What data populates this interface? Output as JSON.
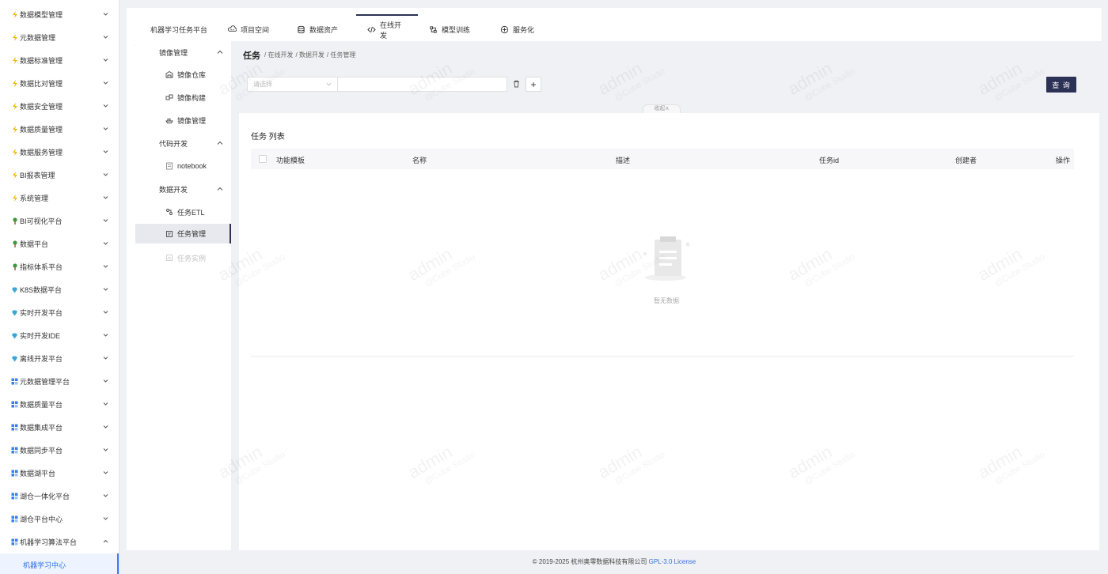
{
  "sidebar": {
    "items": [
      {
        "label": "数据模型管理",
        "icon": "lightning-icon",
        "color": "#f5b800"
      },
      {
        "label": "元数据管理",
        "icon": "lightning-icon",
        "color": "#f5b800"
      },
      {
        "label": "数据标准管理",
        "icon": "lightning-icon",
        "color": "#f5b800"
      },
      {
        "label": "数据比对管理",
        "icon": "lightning-icon",
        "color": "#f5b800"
      },
      {
        "label": "数据安全管理",
        "icon": "lightning-icon",
        "color": "#f5b800"
      },
      {
        "label": "数据质量管理",
        "icon": "lightning-icon",
        "color": "#f5b800"
      },
      {
        "label": "数据服务管理",
        "icon": "lightning-icon",
        "color": "#f5b800"
      },
      {
        "label": "BI报表管理",
        "icon": "lightning-icon",
        "color": "#f5b800"
      },
      {
        "label": "系统管理",
        "icon": "lightning-icon",
        "color": "#f5b800"
      },
      {
        "label": "BI可视化平台",
        "icon": "tree-icon",
        "color": "#3a9a3a"
      },
      {
        "label": "数据平台",
        "icon": "tree-icon",
        "color": "#3a9a3a"
      },
      {
        "label": "指标体系平台",
        "icon": "tree-icon",
        "color": "#3a9a3a"
      },
      {
        "label": "K8S数据平台",
        "icon": "diamond-icon",
        "color": "#3aa7d9"
      },
      {
        "label": "实时开发平台",
        "icon": "diamond-icon",
        "color": "#3aa7d9"
      },
      {
        "label": "实时开发IDE",
        "icon": "diamond-icon",
        "color": "#3aa7d9"
      },
      {
        "label": "离线开发平台",
        "icon": "diamond-icon",
        "color": "#3aa7d9"
      },
      {
        "label": "元数据管理平台",
        "icon": "grid-icon",
        "color": "#3a7df0"
      },
      {
        "label": "数据质量平台",
        "icon": "grid-icon",
        "color": "#3a7df0"
      },
      {
        "label": "数据集成平台",
        "icon": "grid-icon",
        "color": "#3a7df0"
      },
      {
        "label": "数据同步平台",
        "icon": "grid-icon",
        "color": "#3a7df0"
      },
      {
        "label": "数据湖平台",
        "icon": "grid-icon",
        "color": "#3a7df0"
      },
      {
        "label": "湖仓一体化平台",
        "icon": "grid-icon",
        "color": "#3a7df0"
      },
      {
        "label": "湖仓平台中心",
        "icon": "grid-icon",
        "color": "#3a7df0"
      },
      {
        "label": "机器学习算法平台",
        "icon": "grid-icon",
        "color": "#3a7df0"
      }
    ],
    "sub_item": "机器学习中心"
  },
  "topnav": {
    "app_name": "机器学习任务平台",
    "tabs": [
      {
        "label": "项目空间",
        "icon": "cloud-icon"
      },
      {
        "label": "数据资产",
        "icon": "database-icon"
      },
      {
        "label": "在线开发",
        "icon": "code-icon"
      },
      {
        "label": "模型训练",
        "icon": "model-icon"
      },
      {
        "label": "服务化",
        "icon": "service-icon"
      }
    ]
  },
  "subnav": {
    "groups": [
      {
        "label": "镜像管理",
        "items": [
          {
            "label": "镜像仓库",
            "icon": "warehouse-icon"
          },
          {
            "label": "镜像构建",
            "icon": "blocks-icon"
          },
          {
            "label": "镜像管理",
            "icon": "ship-icon"
          }
        ]
      },
      {
        "label": "代码开发",
        "items": [
          {
            "label": "notebook",
            "icon": "notebook-icon"
          }
        ]
      },
      {
        "label": "数据开发",
        "items": [
          {
            "label": "任务ETL",
            "icon": "etl-icon"
          },
          {
            "label": "任务管理",
            "icon": "task-icon"
          },
          {
            "label": "任务实例",
            "icon": "instance-icon"
          }
        ]
      }
    ]
  },
  "page": {
    "title": "任务",
    "breadcrumb": [
      "/ 在线开发",
      "/ 数据开发",
      "/ 任务管理"
    ]
  },
  "filters": {
    "select_placeholder": "请选择",
    "query_label": "查 询",
    "collapse_label": "收起∧"
  },
  "table": {
    "title": "任务 列表",
    "columns": [
      "功能模板",
      "名称",
      "描述",
      "任务id",
      "创建者",
      "操作"
    ],
    "empty_text": "暂无数据"
  },
  "watermark": {
    "line1": "admin",
    "line2": "@Cube Studio"
  },
  "footer": {
    "copyright": "© 2019-2025 杭州奥零数据科技有限公司",
    "license": "GPL-3.0 License"
  }
}
